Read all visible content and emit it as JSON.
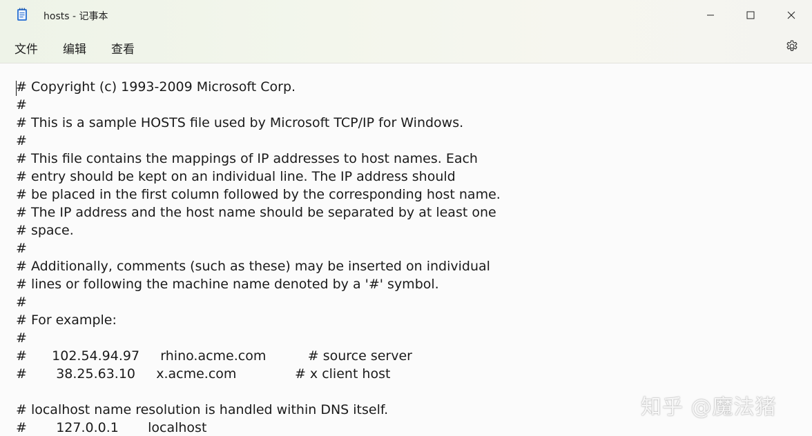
{
  "window": {
    "title": "hosts - 记事本",
    "icons": {
      "app": "notepad-icon",
      "minimize": "minimize-icon",
      "maximize": "maximize-icon",
      "close": "close-icon"
    }
  },
  "menu": {
    "items": [
      "文件",
      "编辑",
      "查看"
    ],
    "settings_icon": "gear-icon"
  },
  "editor": {
    "lines": [
      "# Copyright (c) 1993-2009 Microsoft Corp.",
      "#",
      "# This is a sample HOSTS file used by Microsoft TCP/IP for Windows.",
      "#",
      "# This file contains the mappings of IP addresses to host names. Each",
      "# entry should be kept on an individual line. The IP address should",
      "# be placed in the first column followed by the corresponding host name.",
      "# The IP address and the host name should be separated by at least one",
      "# space.",
      "#",
      "# Additionally, comments (such as these) may be inserted on individual",
      "# lines or following the machine name denoted by a '#' symbol.",
      "#",
      "# For example:",
      "#",
      "#      102.54.94.97     rhino.acme.com          # source server",
      "#       38.25.63.10     x.acme.com              # x client host",
      "",
      "# localhost name resolution is handled within DNS itself.",
      "#       127.0.0.1       localhost"
    ]
  },
  "watermark": "知乎 @魔法猪"
}
